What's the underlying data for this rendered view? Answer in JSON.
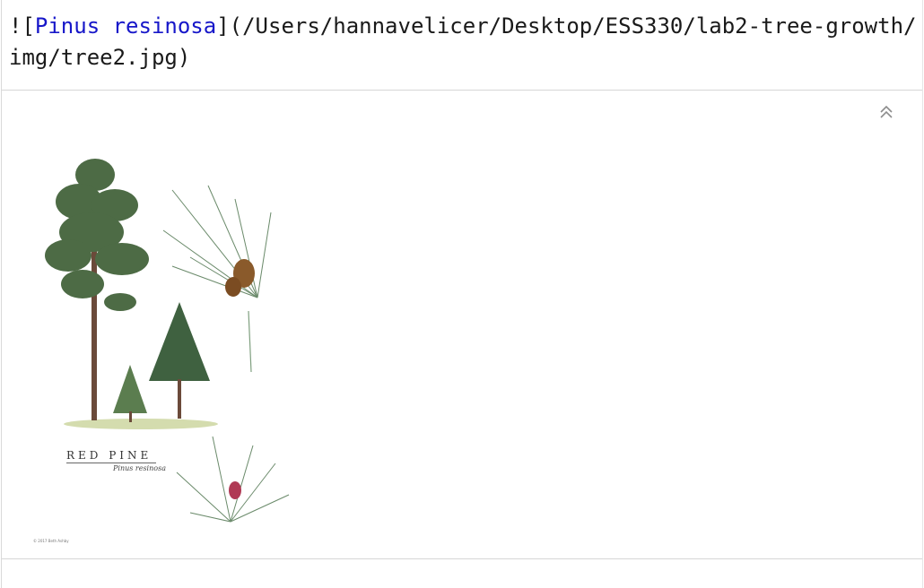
{
  "editor": {
    "prefix": "![",
    "link_text": "Pinus resinosa",
    "path_part": "](/Users/hannavelicer/Desktop/ESS330/lab2-tree-growth/img/tree2.jpg)"
  },
  "preview": {
    "caption_title": "RED PINE",
    "caption_scientific": "Pinus resinosa",
    "copyright": "© 2017 Beth Ashby",
    "collapse_icon": "double-chevron-up-icon"
  },
  "colors": {
    "link": "#1717c9",
    "needle": "#6a8a6a",
    "foliage": "#4d6b45",
    "trunk": "#6b4a3a",
    "cone": "#8a5a2b",
    "flower": "#b03a55"
  }
}
